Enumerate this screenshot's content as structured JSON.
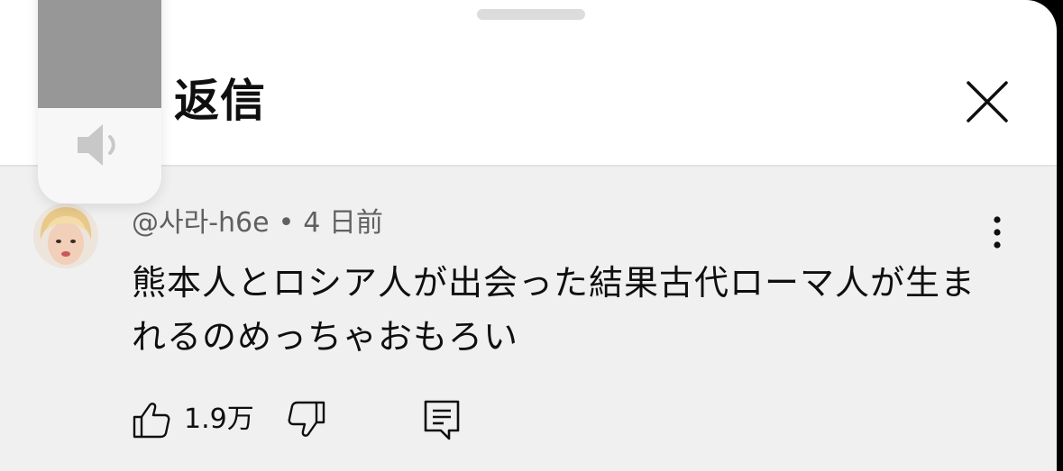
{
  "sheet": {
    "title": "返信"
  },
  "volume_hud": {
    "level_fraction": 0.6
  },
  "comment": {
    "author": "@사라-h6e",
    "separator": "•",
    "time": "4 日前",
    "text": "熊本人とロシア人が出会った結果古代ローマ人が生まれるのめっちゃおもろい",
    "like_count": "1.9万"
  },
  "icons": {
    "close": "close-icon",
    "more": "more-vertical-icon",
    "like": "thumbs-up-icon",
    "dislike": "thumbs-down-icon",
    "reply": "reply-comment-icon",
    "speaker": "speaker-icon"
  },
  "colors": {
    "background": "#ffffff",
    "comment_background": "#f0f0f0",
    "text_primary": "#0f0f0f",
    "text_secondary": "#606060"
  }
}
